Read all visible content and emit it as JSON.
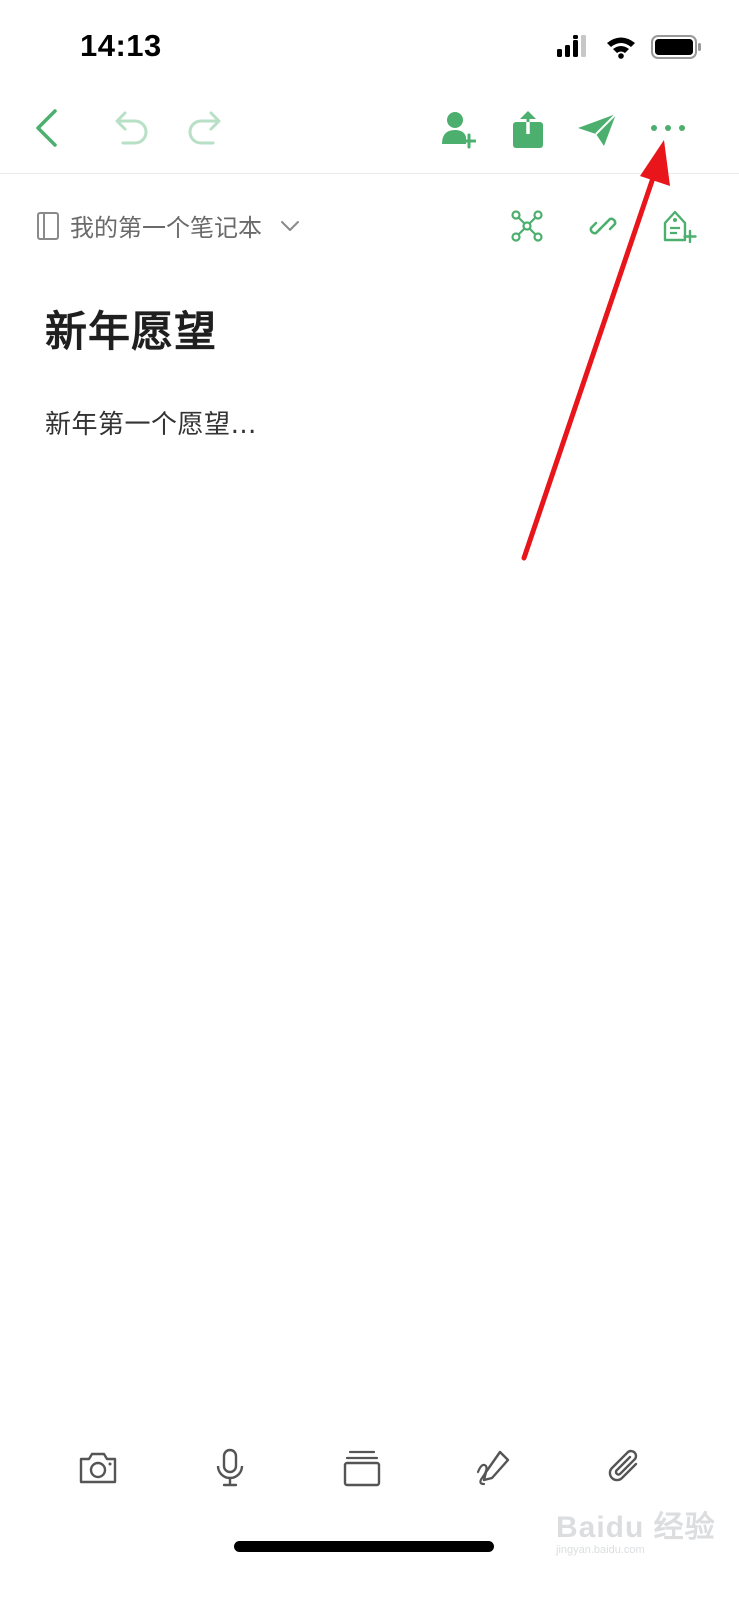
{
  "status_bar": {
    "time": "14:13",
    "icons": [
      "cellular-signal-icon",
      "wifi-icon",
      "battery-icon"
    ]
  },
  "toolbar": {
    "buttons": [
      "back-chevron-icon",
      "undo-icon",
      "redo-icon",
      "add-person-icon",
      "share-icon",
      "send-icon",
      "more-icon"
    ]
  },
  "notebook": {
    "name": "我的第一个笔记本",
    "actions": [
      "mind-map-icon",
      "link-icon",
      "add-tag-icon"
    ]
  },
  "note": {
    "title": "新年愿望",
    "body": "新年第一个愿望…"
  },
  "bottom_bar": {
    "buttons": [
      "camera-icon",
      "microphone-icon",
      "stack-icon",
      "handwriting-icon",
      "attachment-icon"
    ]
  },
  "watermark": {
    "main": "Baidu 经验",
    "sub": "jingyan.baidu.com"
  },
  "colors": {
    "accent": "#4caf6e",
    "accent_light": "#b8e0c6",
    "arrow": "#e8151b",
    "text_primary": "#1f1f1f",
    "text_secondary": "#6a6a6a"
  }
}
